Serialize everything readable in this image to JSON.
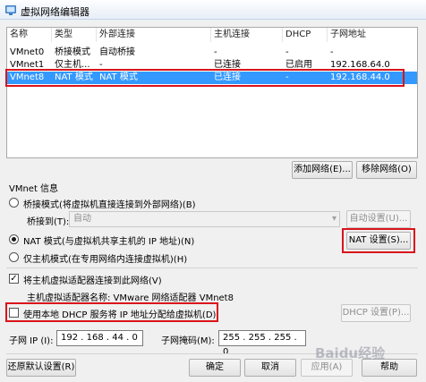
{
  "window": {
    "title": "虚拟网络编辑器"
  },
  "table": {
    "columns": [
      "名称",
      "类型",
      "外部连接",
      "主机连接",
      "DHCP",
      "子网地址"
    ],
    "rows": [
      [
        "VMnet0",
        "桥接模式",
        "自动桥接",
        "-",
        "-",
        "-"
      ],
      [
        "VMnet1",
        "仅主机...",
        "-",
        "已连接",
        "已启用",
        "192.168.64.0"
      ],
      [
        "VMnet8",
        "NAT 模式",
        "NAT 模式",
        "已连接",
        "-",
        "192.168.44.0"
      ]
    ]
  },
  "buttons": {
    "add_network": "添加网络(E)...",
    "remove_network": "移除网络(O)",
    "auto_settings": "自动设置(U)...",
    "nat_settings": "NAT 设置(S)...",
    "dhcp_settings": "DHCP 设置(P)...",
    "restore_defaults": "还原默认设置(R)",
    "ok": "确定",
    "cancel": "取消",
    "apply": "应用(A)",
    "help": "帮助"
  },
  "vmnet_info": {
    "heading": "VMnet 信息",
    "bridged_radio": "桥接模式(将虚拟机直接连接到外部网络)(B)",
    "bridged_to_label": "桥接到(T):",
    "bridged_to_value": "自动",
    "nat_radio": "NAT 模式(与虚拟机共享主机的 IP 地址)(N)",
    "hostonly_radio": "仅主机模式(在专用网络内连接虚拟机)(H)",
    "connect_adapter_checkbox": "将主机虚拟适配器连接到此网络(V)",
    "adapter_name_line": "主机虚拟适配器名称: VMware 网络适配器 VMnet8",
    "dhcp_checkbox": "使用本地 DHCP 服务将 IP 地址分配给虚拟机(D)",
    "subnet_ip_label": "子网 IP (I):",
    "subnet_ip_value": "192 . 168 . 44 . 0",
    "subnet_mask_label": "子网掩码(M):",
    "subnet_mask_value": "255 . 255 . 255 . 0"
  },
  "watermark": "Baidu经验",
  "colors": {
    "selection": "#3399ff",
    "highlight_box": "#d9141b"
  }
}
